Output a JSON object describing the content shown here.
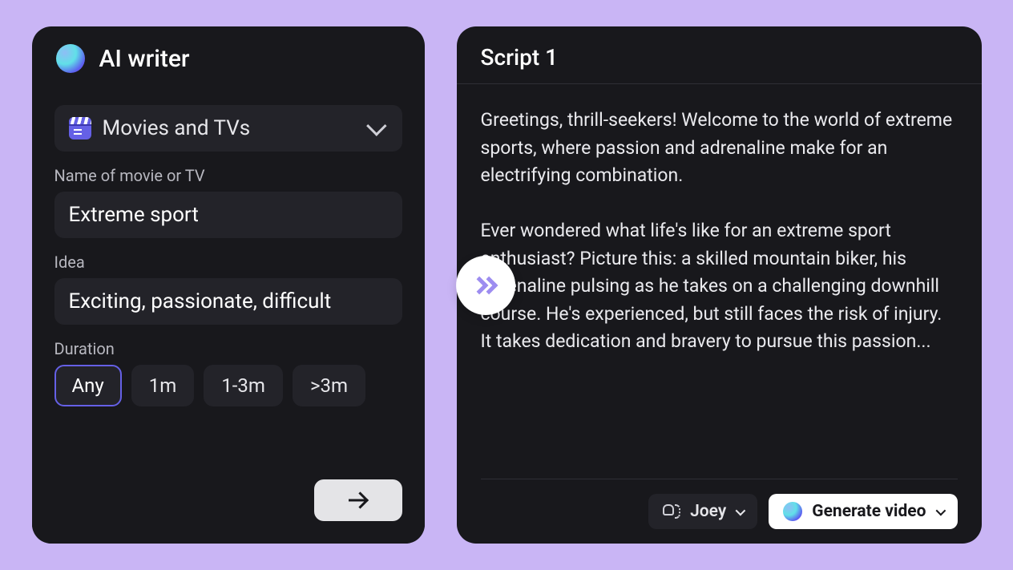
{
  "left": {
    "title": "AI writer",
    "category": {
      "selected": "Movies and TVs"
    },
    "fields": {
      "name_label": "Name of movie or TV",
      "name_value": "Extreme sport",
      "idea_label": "Idea",
      "idea_value": "Exciting, passionate, difficult",
      "duration_label": "Duration"
    },
    "durations": [
      {
        "label": "Any",
        "active": true
      },
      {
        "label": "1m",
        "active": false
      },
      {
        "label": "1-3m",
        "active": false
      },
      {
        "label": ">3m",
        "active": false
      }
    ]
  },
  "right": {
    "title": "Script 1",
    "content": "Greetings, thrill-seekers! Welcome to the world of extreme sports, where passion and adrenaline make for an electrifying combination.\n\nEver wondered what life's like for an extreme sport enthusiast? Picture this: a skilled mountain biker, his adrenaline pulsing as he takes on a challenging downhill course. He's experienced, but still faces the risk of injury. It takes dedication and bravery to pursue this passion...",
    "voice": "Joey",
    "generate_label": "Generate video"
  }
}
